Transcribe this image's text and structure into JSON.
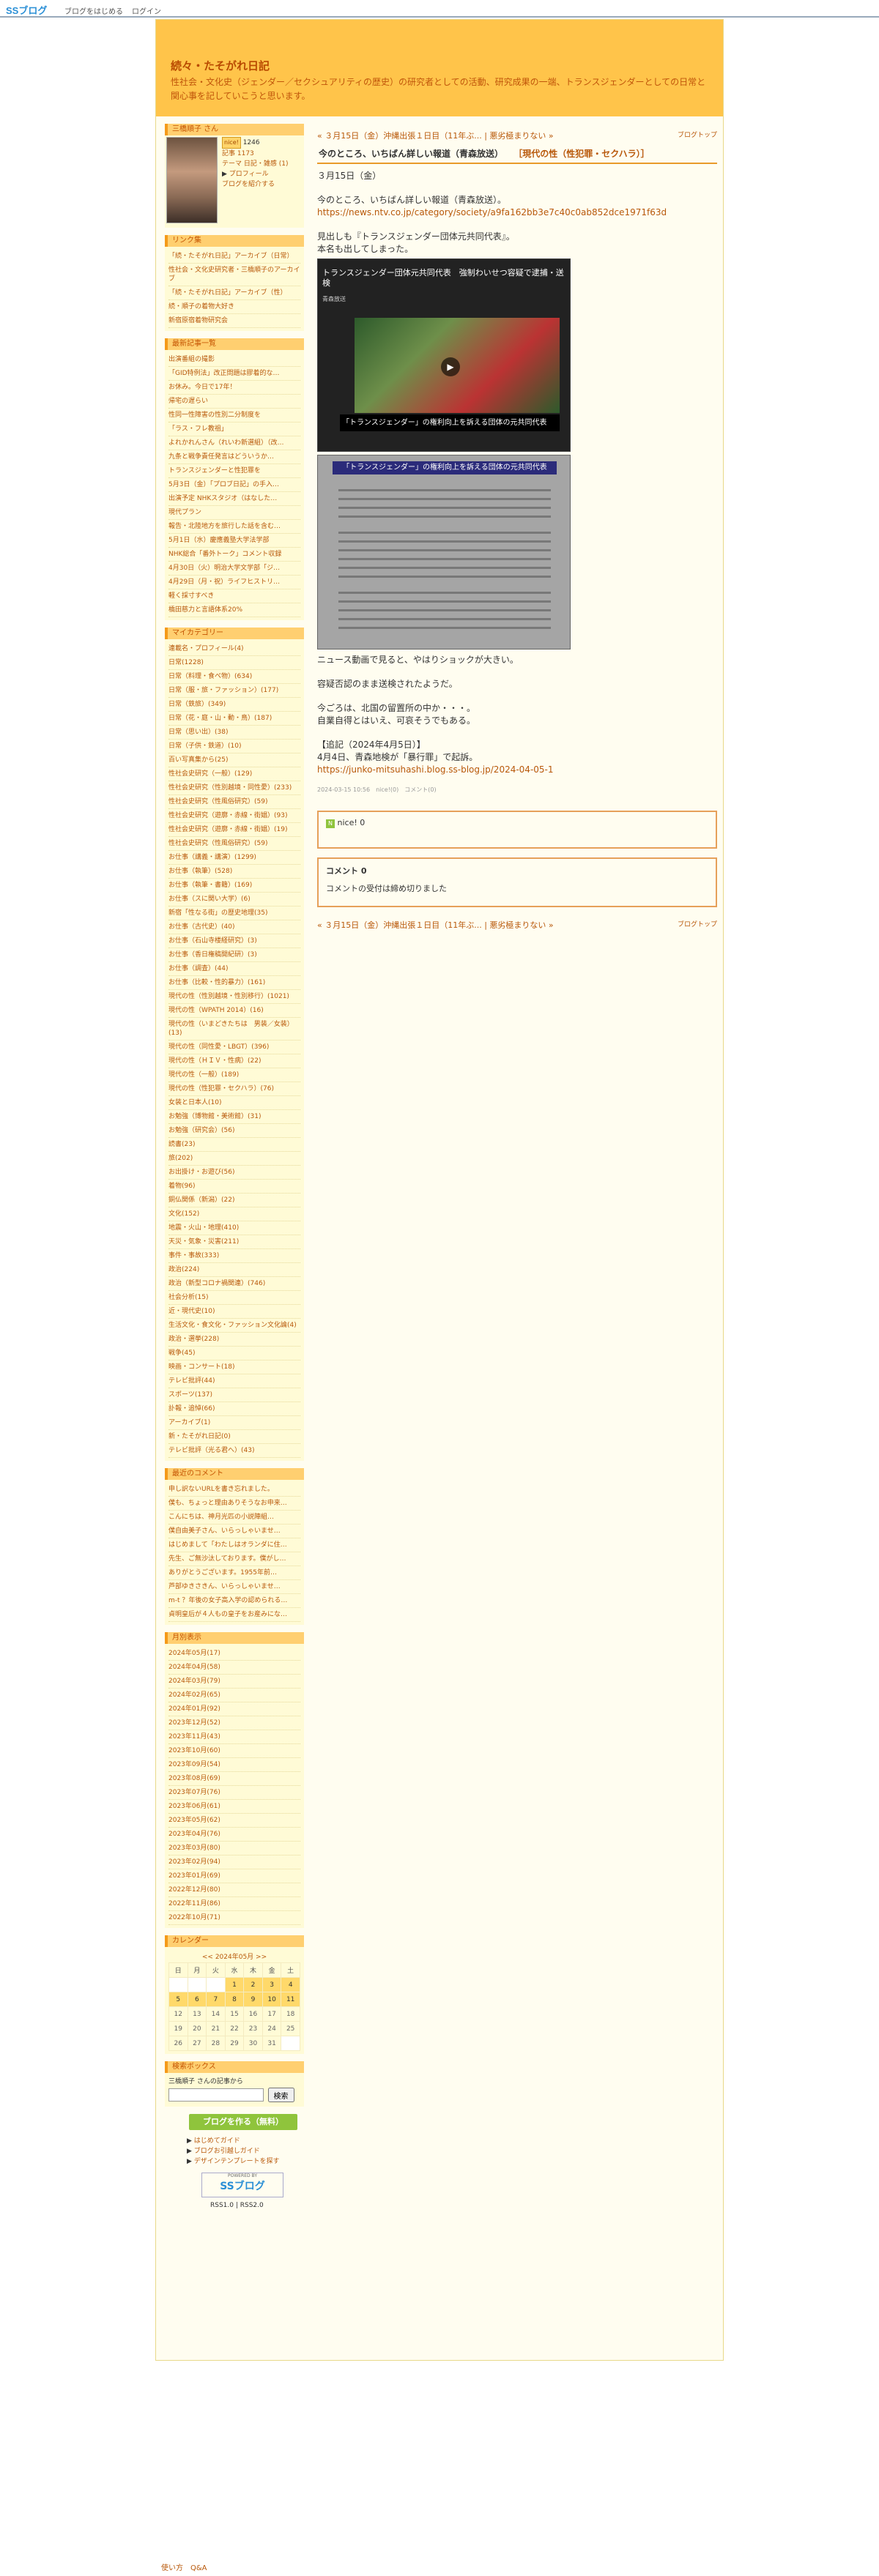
{
  "topbar": {
    "logo": "SSブログ",
    "links": [
      "ブログをはじめる",
      "ログイン"
    ]
  },
  "header": {
    "title": "続々・たそがれ日記",
    "description": "性社会・文化史（ジェンダー／セクシュアリティの歴史）の研究者としての活動、研究成果の一端、トランスジェンダーとしての日常と関心事を記していこうと思います。"
  },
  "profile": {
    "heading": "三橋順子 さん",
    "nice": "nice!",
    "nice_count": "1246",
    "articles": "記事 1173",
    "blog_links": [
      "テーマ 日記・雑感 (1)"
    ],
    "profile_link": "プロフィール",
    "share_link": "ブログを紹介する"
  },
  "links": {
    "heading": "リンク集",
    "items": [
      "「続・たそがれ日記」アーカイブ（日常）",
      "性社会・文化史研究者・三橋順子のアーカイブ",
      "「続・たそがれ日記」アーカイブ（性）",
      "続・順子の着物大好き",
      "新宿原宿着物研究会"
    ]
  },
  "recent": {
    "heading": "最新記事一覧",
    "items": [
      "出演番組の撮影",
      "「GID特例法」改正問題は膠着的な…",
      "お休み。今日で17年！",
      "帰宅の遅らい",
      "性同一性障害の性別二分制度を",
      "「ラス・フレ教祖」",
      "よれかれんさん（れいわ新選組）（改…",
      "九条と戦争責任発言はどういうか…",
      "トランスジェンダーと性犯罪を",
      "5月3日（金）「プロブ日記」の手入…",
      "出演予定 NHKスタジオ（はなした…",
      "現代プラン",
      "報告・北陸地方を旅行した話を含む…",
      "5月1日（水）慶應義塾大学法学部",
      "NHK総合「番外トーク」コメント収録",
      "4月30日（火）明治大学文学部「ジ…",
      "4月29日（月・祝）ライフヒストリ…",
      "軽く採寸すべき",
      "橋田慈力と言語体系20%"
    ]
  },
  "categories": {
    "heading": "マイカテゴリー",
    "items": [
      "連載名・プロフィール(4)",
      "日常(1228)",
      "日常（料理・食べ物）(634)",
      "日常（服・旅・ファッション）(177)",
      "日常（鉄旅）(349)",
      "日常（花・庭・山・動・鳥）(187)",
      "日常（思い出）(38)",
      "日常（子供・鉄道）(10)",
      "百い写真集から(25)",
      "性社会史研究（一般）(129)",
      "性社会史研究（性別越境・同性愛）(233)",
      "性社会史研究（性風俗研究）(59)",
      "性社会史研究（遊廓・赤線・街娼）(93)",
      "性社会史研究（遊廓・赤線・街娼）(19)",
      "性社会史研究（性風俗研究）(59)",
      "お仕事（講義・講演）(1299)",
      "お仕事（執筆）(528)",
      "お仕事（執筆・書籍）(169)",
      "お仕事（スに関い大学）(6)",
      "新宿「性なる街」の歴史地理(35)",
      "お仕事（古代史）(40)",
      "お仕事（石山寺楼経研究）(3)",
      "お仕事（香日権稿開紀研）(3)",
      "お仕事（調査）(44)",
      "お仕事（比較・性的暴力）(161)",
      "現代の性（性別越境・性別移行）(1021)",
      "現代の性（WPATH 2014）(16)",
      "現代の性（いまどきたちは　男装／女装）(13)",
      "現代の性（同性愛・LBGT）(396)",
      "現代の性（ＨＩＶ・性病）(22)",
      "現代の性（一般）(189)",
      "現代の性（性犯罪・セクハラ）(76)",
      "女装と日本人(10)",
      "お勉強（博物館・美術館）(31)",
      "お勉強（研究会）(56)",
      "読書(23)",
      "旅(202)",
      "お出掛け・お遊び(56)",
      "着物(96)",
      "銅仏関係（新潟）(22)",
      "文化(152)",
      "地震・火山・地理(410)",
      "天災・気象・災害(211)",
      "事件・事故(333)",
      "政治(224)",
      "政治（新型コロナ禍関連）(746)",
      "社会分析(15)",
      "近・現代史(10)",
      "生活文化・食文化・ファッション文化論(4)",
      "政治・選挙(228)",
      "戦争(45)",
      "映画・コンサート(18)",
      "テレビ批評(44)",
      "スポーツ(137)",
      "訃報・追悼(66)",
      "アーカイブ(1)",
      "新・たそがれ日記(0)",
      "テレビ批評（光る君へ）(43)"
    ]
  },
  "comments": {
    "heading": "最近のコメント",
    "items": [
      "申し訳ないURLを書き忘れました。",
      "僕も、ちょっと理由ありそうなお申来…",
      "こんにちは、神月光匹の小説陣組…",
      "僕自由美子さん、いらっしゃいませ…",
      "はじめまして「わたしはオランダに住…",
      "先生、ご無沙汰しております。僕がし…",
      "ありがとうございます。1955年前…",
      "芦部ゆきさきん、いらっしゃいませ…",
      "m-t ？年後の女子高入学の認められる…",
      "貞明皇后が４人もの皇子をお産みにな…"
    ]
  },
  "archive": {
    "heading": "月別表示",
    "items": [
      "2024年05月(17)",
      "2024年04月(58)",
      "2024年03月(79)",
      "2024年02月(65)",
      "2024年01月(92)",
      "2023年12月(52)",
      "2023年11月(43)",
      "2023年10月(60)",
      "2023年09月(54)",
      "2023年08月(69)",
      "2023年07月(76)",
      "2023年06月(61)",
      "2023年05月(62)",
      "2023年04月(76)",
      "2023年03月(80)",
      "2023年02月(94)",
      "2023年01月(69)",
      "2022年12月(80)",
      "2022年11月(86)",
      "2022年10月(71)"
    ]
  },
  "calendar": {
    "heading": "カレンダー",
    "title": "<< 2024年05月 >>",
    "weekdays": [
      "日",
      "月",
      "火",
      "水",
      "木",
      "金",
      "土"
    ],
    "weeks": [
      [
        "",
        "",
        "",
        "1",
        "2",
        "3",
        "4"
      ],
      [
        "5",
        "6",
        "7",
        "8",
        "9",
        "10",
        "11"
      ],
      [
        "12",
        "13",
        "14",
        "15",
        "16",
        "17",
        "18"
      ],
      [
        "19",
        "20",
        "21",
        "22",
        "23",
        "24",
        "25"
      ],
      [
        "26",
        "27",
        "28",
        "29",
        "30",
        "31",
        ""
      ]
    ]
  },
  "search": {
    "heading": "検索ボックス",
    "label": "三橋順子 さんの記事から",
    "button": "検索",
    "placeholder": ""
  },
  "bottom_links": {
    "create": "ブログを作る（無料）",
    "items": [
      "はじめてガイド",
      "ブログお引越しガイド",
      "デザインテンプレートを探す"
    ],
    "powered": "POWERED BY",
    "logo": "SSブログ",
    "rss": "RSS1.0 | RSS2.0"
  },
  "entry": {
    "nav_prev": "« ３月15日（金）沖縄出張１日目（11年ぶ... | 悪劣極まりない »",
    "nav_top": "ブログトップ",
    "title": "今のところ、いちばん詳しい報道（青森放送）",
    "category": "［現代の性（性犯罪・セクハラ）］",
    "date": "３月15日（金）",
    "p1": "今のところ、いちばん詳しい報道（青森放送）。",
    "url1": "https://news.ntv.co.jp/category/society/a9fa162bb3e7c40c0ab852dce1971f63d",
    "p2a": "見出しも『トランスジェンダー団体元共同代表』。",
    "p2b": "本名も出してしまった。",
    "img1_title": "トランスジェンダー団体元共同代表　強制わいせつ容疑で逮捕・送検",
    "img1_src": "青森放送",
    "img1_cap": "「トランスジェンダー」の権利向上を訴える団体の元共同代表",
    "img2_bar": "「トランスジェンダー」の権利向上を訴える団体の元共同代表",
    "p3": "ニュース動画で見ると、やはりショックが大きい。",
    "p4": "容疑否認のまま送検されたようだ。",
    "p5a": "今ごろは、北国の留置所の中か・・・。",
    "p5b": "自業自得とはいえ、可哀そうでもある。",
    "p6a": "【追記（2024年4月5日）】",
    "p6b": "4月4日、青森地検が「暴行罪」で起訴。",
    "url2": "https://junko-mitsuhashi.blog.ss-blog.jp/2024-04-05-1",
    "meta": "2024-03-15 10:56　nice!(0)　コメント(0)",
    "nice_label": "nice! 0",
    "comment_heading": "コメント 0",
    "comment_text": "コメントの受付は締め切りました"
  },
  "footer": {
    "text": "使い方　Q&A"
  }
}
